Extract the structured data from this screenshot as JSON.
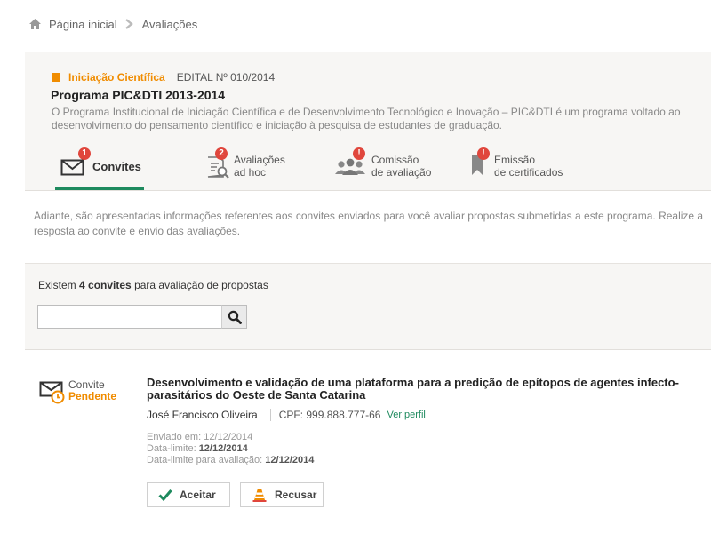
{
  "breadcrumb": {
    "home": "Página inicial",
    "current": "Avaliações"
  },
  "program": {
    "category": "Iniciação Científica",
    "edital": "EDITAL Nº 010/2014",
    "title": "Programa PIC&DTI 2013-2014",
    "description": "O Programa Institucional de Iniciação Científica e de Desenvolvimento Tecnológico e Inovação – PIC&DTI é um programa voltado ao desenvolvimento do pensamento científico e iniciação à pesquisa de estudantes de graduação.",
    "category_color": "#f08c00"
  },
  "tabs": [
    {
      "label": "Convites",
      "badge": "1",
      "icon": "envelope-icon",
      "active": true
    },
    {
      "label_line1": "Avaliações",
      "label_line2": "ad hoc",
      "badge": "2",
      "icon": "document-search-icon"
    },
    {
      "label_line1": "Comissão",
      "label_line2": "de avaliação",
      "badge": "!",
      "icon": "group-icon"
    },
    {
      "label_line1": "Emissão",
      "label_line2": "de certificados",
      "badge": "!",
      "icon": "certificate-bookmark-icon"
    }
  ],
  "intro": "Adiante, são apresentadas informações referentes aos convites enviados para você avaliar propostas submetidas a este programa. Realize a resposta ao convite e envio das avaliações.",
  "invites": {
    "count_prefix": "Existem",
    "count_bold": "4 convites",
    "count_suffix": "para avaliação de propostas",
    "search_placeholder": "",
    "search_icon": "magnifier-icon"
  },
  "invite_item": {
    "status_label": "Convite",
    "status": "Pendente",
    "title": "Desenvolvimento e validação de uma plataforma para a predição de epítopos de agentes infecto-parasitários do Oeste de Santa Catarina",
    "proponent": "José Francisco Oliveira",
    "cpf": "CPF: 999.888.777-66",
    "profile_link": "Ver perfil",
    "sent_label": "Enviado em:",
    "sent_date": "12/12/2014",
    "deadline_label": "Data-limite:",
    "deadline_date": "12/12/2014",
    "eval_deadline_label": "Data-limite para avaliação:",
    "eval_deadline_date": "12/12/2014",
    "accept_label": "Aceitar",
    "refuse_label": "Recusar"
  },
  "colors": {
    "accent": "#1e8a5e",
    "orange": "#f08c00",
    "badge": "#e0463c"
  }
}
